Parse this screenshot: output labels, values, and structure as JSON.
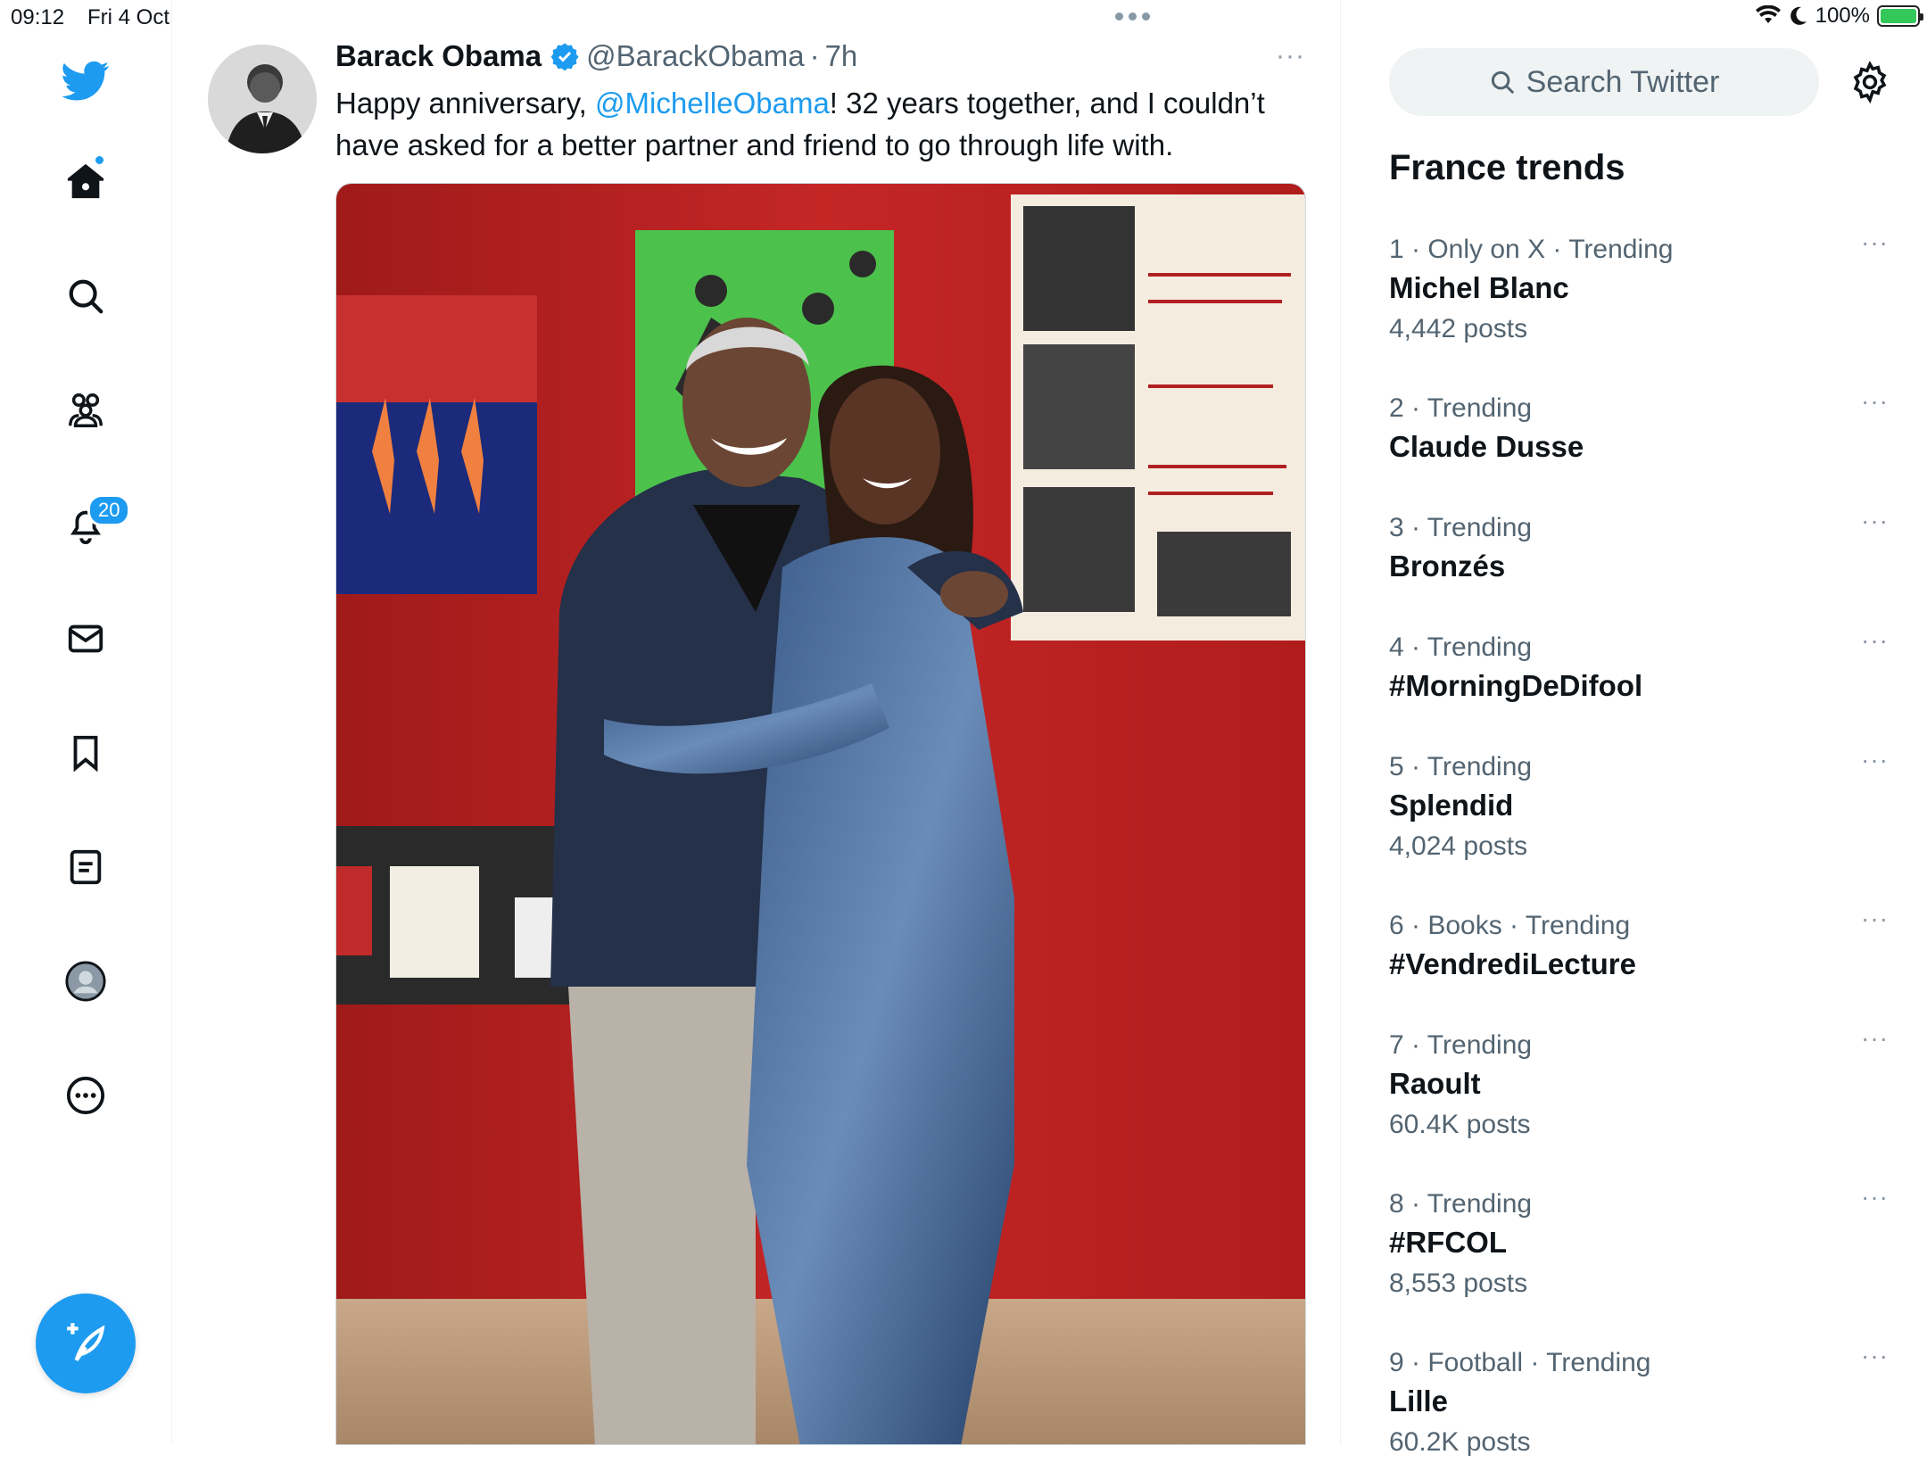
{
  "status_bar": {
    "time": "09:12",
    "date": "Fri 4 Oct",
    "battery": "100%"
  },
  "nav": {
    "notifications_count": "20",
    "icons": [
      "twitter-logo-icon",
      "home-icon",
      "search-icon",
      "communities-icon",
      "notifications-icon",
      "messages-icon",
      "bookmarks-icon",
      "lists-icon",
      "profile-icon",
      "more-icon",
      "compose-icon"
    ]
  },
  "tweet": {
    "author_name": "Barack Obama",
    "handle": "@BarackObama",
    "separator": "·",
    "time": "7h",
    "more": "···",
    "text_before": "Happy anniversary, ",
    "mention": "@MichelleObama",
    "text_after": "! 32 years together, and I couldn’t have asked for a better partner and friend to go through life with."
  },
  "sidebar": {
    "search_placeholder": "Search Twitter",
    "trends_title": "France trends",
    "trends": [
      {
        "meta": "1 · Only on X · Trending",
        "name": "Michel Blanc",
        "posts": "4,442 posts"
      },
      {
        "meta": "2 · Trending",
        "name": "Claude Dusse",
        "posts": ""
      },
      {
        "meta": "3 · Trending",
        "name": "Bronzés",
        "posts": ""
      },
      {
        "meta": "4 · Trending",
        "name": "#MorningDeDifool",
        "posts": ""
      },
      {
        "meta": "5 · Trending",
        "name": "Splendid",
        "posts": "4,024 posts"
      },
      {
        "meta": "6 · Books · Trending",
        "name": "#VendrediLecture",
        "posts": ""
      },
      {
        "meta": "7 · Trending",
        "name": "Raoult",
        "posts": "60.4K posts"
      },
      {
        "meta": "8 · Trending",
        "name": "#RFCOL",
        "posts": "8,553 posts"
      },
      {
        "meta": "9 · Football · Trending",
        "name": "Lille",
        "posts": "60.2K posts"
      }
    ],
    "more": "···"
  },
  "colors": {
    "accent": "#1d9bf0",
    "text": "#0f1419",
    "muted": "#536471",
    "battery": "#34c759"
  }
}
